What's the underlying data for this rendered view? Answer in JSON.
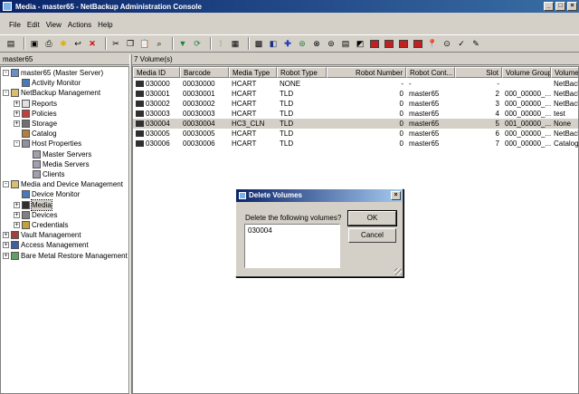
{
  "window": {
    "title": "Media - master65 - NetBackup Administration Console",
    "min": "_",
    "max": "□",
    "close": "×"
  },
  "menu": [
    "File",
    "Edit",
    "View",
    "Actions",
    "Help"
  ],
  "left_pane": {
    "header": "master65"
  },
  "tree": [
    {
      "label": "master65 (Master Server)",
      "indent": 0,
      "exp": "-",
      "icon": "server-icon",
      "color": "#6a8fc7"
    },
    {
      "label": "Activity Monitor",
      "indent": 1,
      "exp": "",
      "icon": "monitor-icon",
      "color": "#4a7ab8"
    },
    {
      "label": "NetBackup Management",
      "indent": 0,
      "exp": "-",
      "icon": "folder-icon",
      "color": "#d8c070"
    },
    {
      "label": "Reports",
      "indent": 1,
      "exp": "+",
      "icon": "report-icon",
      "color": "#e0e0e0"
    },
    {
      "label": "Policies",
      "indent": 1,
      "exp": "+",
      "icon": "policy-icon",
      "color": "#c04040"
    },
    {
      "label": "Storage",
      "indent": 1,
      "exp": "+",
      "icon": "storage-icon",
      "color": "#707070"
    },
    {
      "label": "Catalog",
      "indent": 1,
      "exp": "",
      "icon": "catalog-icon",
      "color": "#b08040"
    },
    {
      "label": "Host Properties",
      "indent": 1,
      "exp": "-",
      "icon": "host-icon",
      "color": "#9090a0"
    },
    {
      "label": "Master Servers",
      "indent": 2,
      "exp": "",
      "icon": "server-icon",
      "color": "#a0a0b0"
    },
    {
      "label": "Media Servers",
      "indent": 2,
      "exp": "",
      "icon": "server-icon",
      "color": "#a0a0b0"
    },
    {
      "label": "Clients",
      "indent": 2,
      "exp": "",
      "icon": "client-icon",
      "color": "#a0a0b0"
    },
    {
      "label": "Media and Device Management",
      "indent": 0,
      "exp": "-",
      "icon": "folder-icon",
      "color": "#d8c070"
    },
    {
      "label": "Device Monitor",
      "indent": 1,
      "exp": "",
      "icon": "device-monitor-icon",
      "color": "#4a7ab8"
    },
    {
      "label": "Media",
      "indent": 1,
      "exp": "+",
      "icon": "media-icon",
      "color": "#303030",
      "selected": true
    },
    {
      "label": "Devices",
      "indent": 1,
      "exp": "+",
      "icon": "devices-icon",
      "color": "#808080"
    },
    {
      "label": "Credentials",
      "indent": 1,
      "exp": "+",
      "icon": "credentials-icon",
      "color": "#c0a040"
    },
    {
      "label": "Vault Management",
      "indent": 0,
      "exp": "+",
      "icon": "vault-icon",
      "color": "#a04040"
    },
    {
      "label": "Access Management",
      "indent": 0,
      "exp": "+",
      "icon": "access-icon",
      "color": "#4060a0"
    },
    {
      "label": "Bare Metal Restore Management",
      "indent": 0,
      "exp": "+",
      "icon": "bmr-icon",
      "color": "#60a060"
    }
  ],
  "right_pane": {
    "header": "7 Volume(s)"
  },
  "table": {
    "columns": [
      "Media ID",
      "Barcode",
      "Media Type",
      "Robot Type",
      "Robot Number",
      "Robot Cont...",
      "Slot",
      "Volume Group",
      "Volume Pool"
    ],
    "rows": [
      [
        "030000",
        "00030000",
        "HCART",
        "NONE",
        "-",
        "-",
        "-",
        "",
        "NetBackup"
      ],
      [
        "030001",
        "00030001",
        "HCART",
        "TLD",
        "0",
        "master65",
        "2",
        "000_00000_...",
        "NetBackup"
      ],
      [
        "030002",
        "00030002",
        "HCART",
        "TLD",
        "0",
        "master65",
        "3",
        "000_00000_...",
        "NetBackup"
      ],
      [
        "030003",
        "00030003",
        "HCART",
        "TLD",
        "0",
        "master65",
        "4",
        "000_00000_...",
        "test"
      ],
      [
        "030004",
        "00030004",
        "HC3_CLN",
        "TLD",
        "0",
        "master65",
        "5",
        "001_00000_...",
        "None"
      ],
      [
        "030005",
        "00030005",
        "HCART",
        "TLD",
        "0",
        "master65",
        "6",
        "000_00000_...",
        "NetBackup"
      ],
      [
        "030006",
        "00030006",
        "HCART",
        "TLD",
        "0",
        "master65",
        "7",
        "000_00000_...",
        "CatalogBa..."
      ]
    ],
    "selected_row": 4
  },
  "dialog": {
    "title": "Delete Volumes",
    "close": "×",
    "prompt": "Delete the following volumes?",
    "volumes": "030004",
    "ok_label": "OK",
    "cancel_label": "Cancel"
  }
}
